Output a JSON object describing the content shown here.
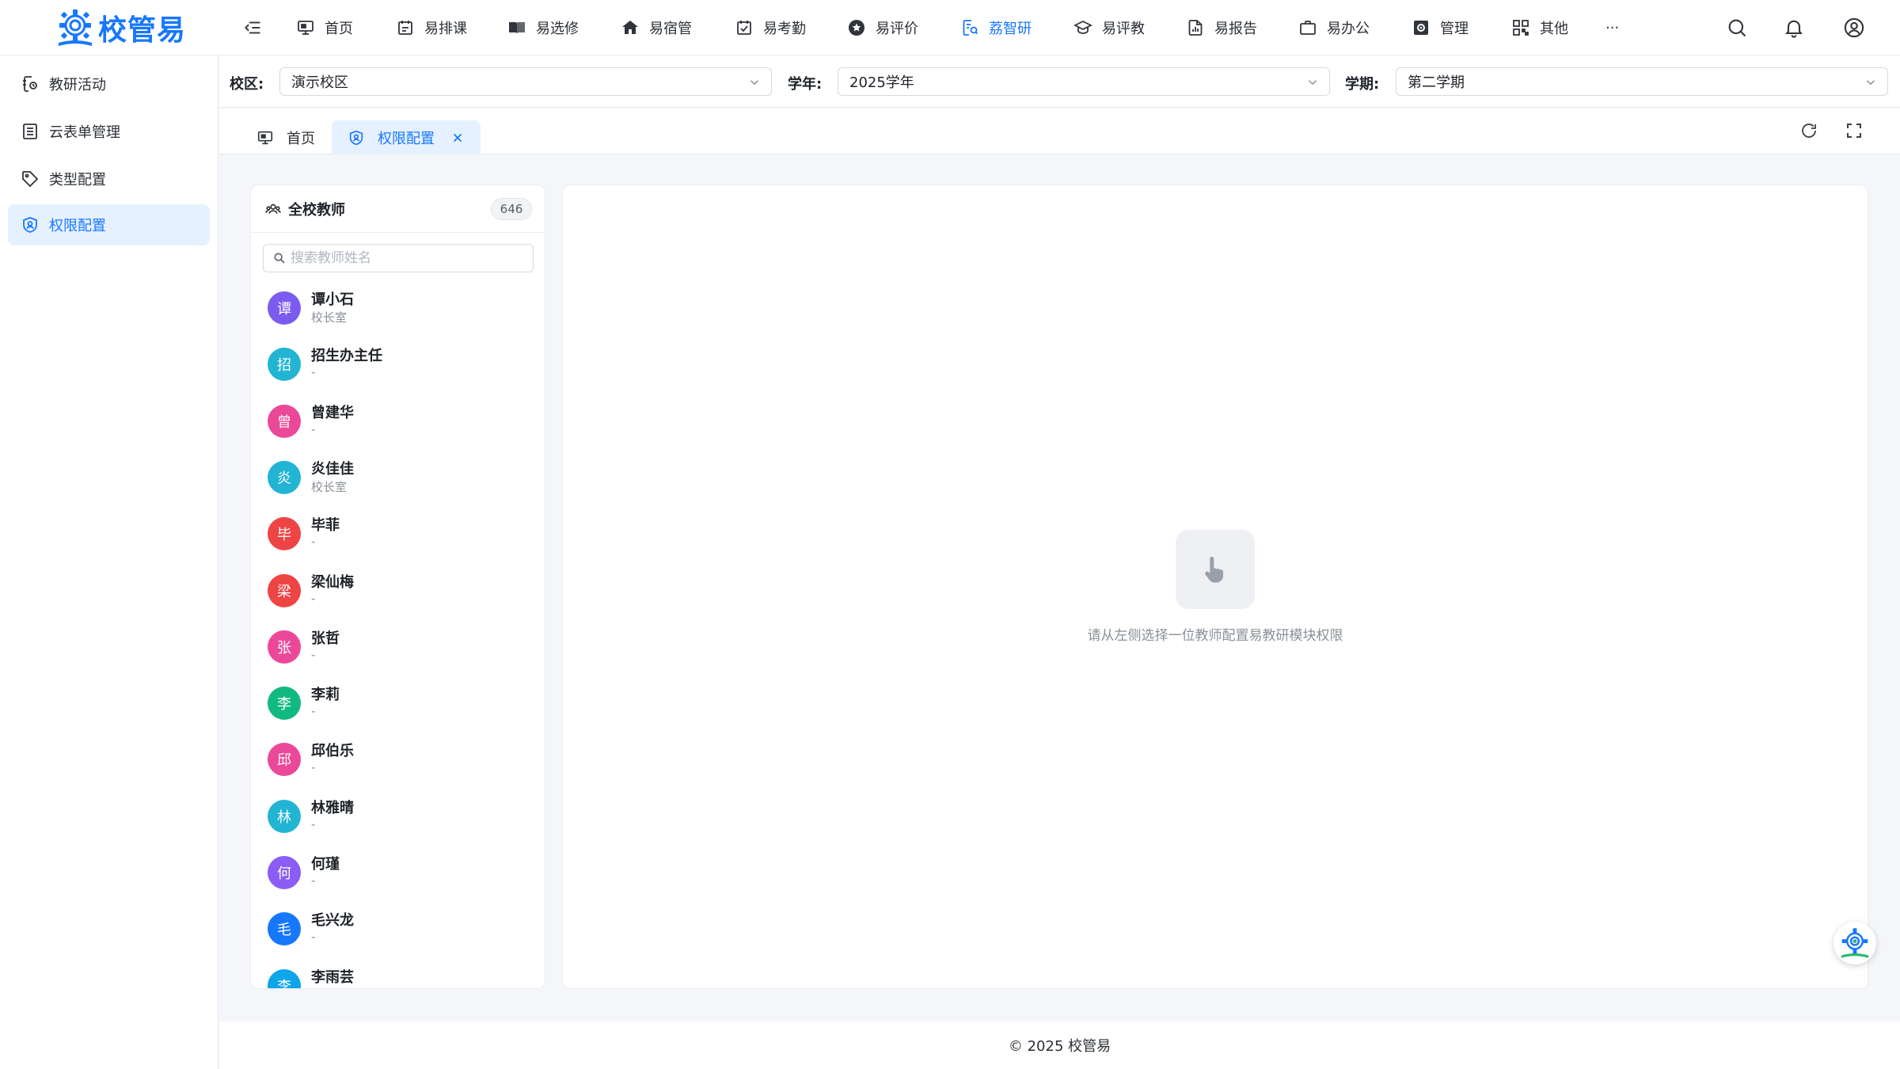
{
  "app": {
    "logo_text": "校管易",
    "brand_color": "#1677ff"
  },
  "nav": {
    "items": [
      {
        "label": "首页",
        "icon": "monitor-icon"
      },
      {
        "label": "易排课",
        "icon": "schedule-icon"
      },
      {
        "label": "易选修",
        "icon": "book-icon"
      },
      {
        "label": "易宿管",
        "icon": "home-icon"
      },
      {
        "label": "易考勤",
        "icon": "calendar-check-icon"
      },
      {
        "label": "易评价",
        "icon": "star-icon"
      },
      {
        "label": "荔智研",
        "icon": "research-icon",
        "active": true
      },
      {
        "label": "易评教",
        "icon": "graduation-icon"
      },
      {
        "label": "易报告",
        "icon": "report-icon"
      },
      {
        "label": "易办公",
        "icon": "briefcase-icon"
      },
      {
        "label": "管理",
        "icon": "settings-box-icon"
      },
      {
        "label": "其他",
        "icon": "grid-icon"
      }
    ],
    "more": "···"
  },
  "sidebar": {
    "items": [
      {
        "label": "教研活动",
        "icon": "activity-icon"
      },
      {
        "label": "云表单管理",
        "icon": "form-icon"
      },
      {
        "label": "类型配置",
        "icon": "tag-icon"
      },
      {
        "label": "权限配置",
        "icon": "permission-icon",
        "active": true
      }
    ]
  },
  "filters": {
    "campus_label": "校区:",
    "campus_value": "演示校区",
    "year_label": "学年:",
    "year_value": "2025学年",
    "term_label": "学期:",
    "term_value": "第二学期"
  },
  "tabs": [
    {
      "label": "首页"
    },
    {
      "label": "权限配置",
      "active": true
    }
  ],
  "teacher_panel": {
    "title": "全校教师",
    "count": "646",
    "search_placeholder": "搜索教师姓名",
    "teachers": [
      {
        "avatar": "谭",
        "name": "谭小石",
        "dept": "校长室",
        "color": "#7c5cf0"
      },
      {
        "avatar": "招",
        "name": "招生办主任",
        "dept": "-",
        "color": "#22b5d3"
      },
      {
        "avatar": "曾",
        "name": "曾建华",
        "dept": "-",
        "color": "#ec4899"
      },
      {
        "avatar": "炎",
        "name": "炎佳佳",
        "dept": "校长室",
        "color": "#22b5d3"
      },
      {
        "avatar": "毕",
        "name": "毕菲",
        "dept": "-",
        "color": "#ef4444"
      },
      {
        "avatar": "梁",
        "name": "梁仙梅",
        "dept": "-",
        "color": "#ef4444"
      },
      {
        "avatar": "张",
        "name": "张哲",
        "dept": "-",
        "color": "#ec4899"
      },
      {
        "avatar": "李",
        "name": "李莉",
        "dept": "-",
        "color": "#10b981"
      },
      {
        "avatar": "邱",
        "name": "邱伯乐",
        "dept": "-",
        "color": "#ec4899"
      },
      {
        "avatar": "林",
        "name": "林雅晴",
        "dept": "-",
        "color": "#22b5d3"
      },
      {
        "avatar": "何",
        "name": "何瑾",
        "dept": "-",
        "color": "#8b5cf6"
      },
      {
        "avatar": "毛",
        "name": "毛兴龙",
        "dept": "-",
        "color": "#1677ff"
      },
      {
        "avatar": "李",
        "name": "李雨芸",
        "dept": "-",
        "color": "#0ea5e9"
      }
    ]
  },
  "main": {
    "empty_text": "请从左侧选择一位教师配置易教研模块权限"
  },
  "footer": {
    "text": "© 2025 校管易"
  }
}
